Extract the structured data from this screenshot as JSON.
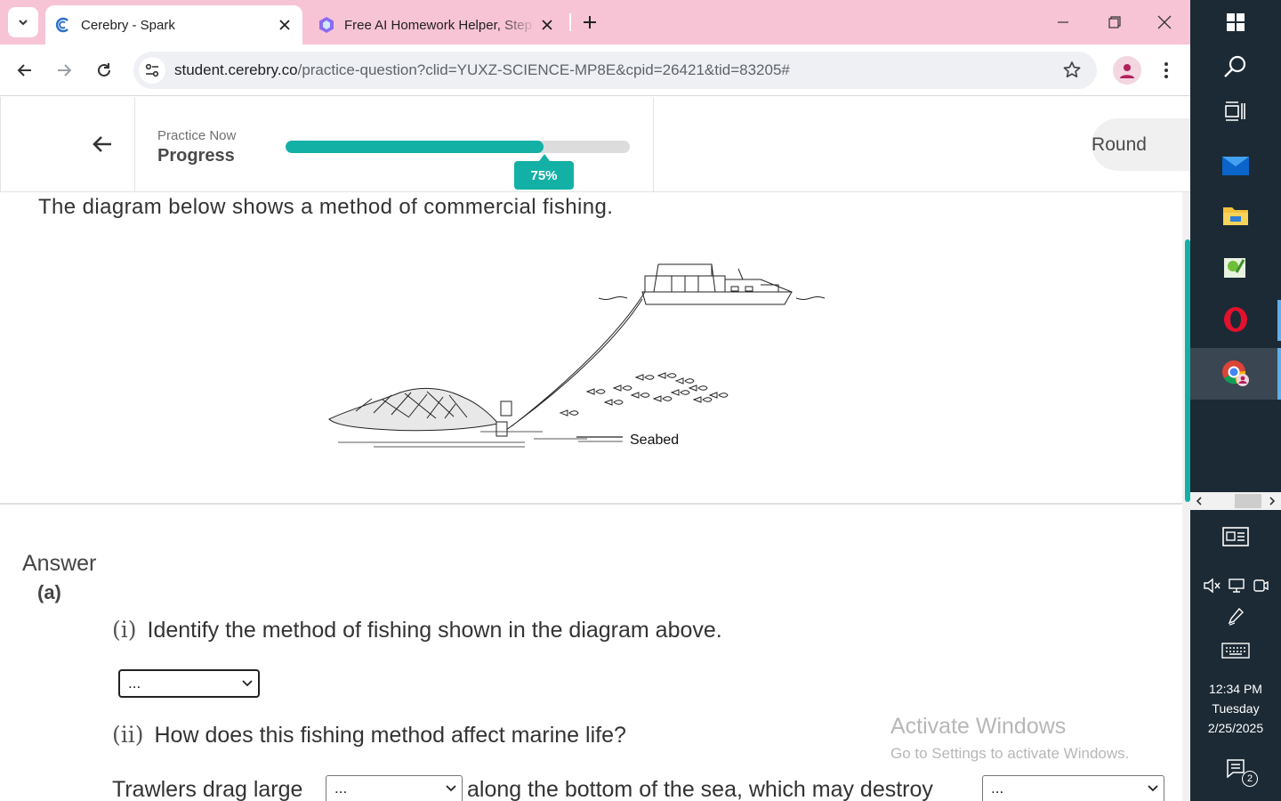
{
  "browser": {
    "tabs": [
      {
        "title": "Cerebry - Spark",
        "active": true,
        "icon": "cerebry-icon"
      },
      {
        "title": "Free AI Homework Helper, Step",
        "active": false,
        "icon": "ai-helper-icon"
      }
    ],
    "url_host": "student.cerebry.co",
    "url_path": "/practice-question?clid=YUXZ-SCIENCE-MP8E&cpid=26421&tid=83205#"
  },
  "header": {
    "progress_kicker": "Practice Now",
    "progress_label": "Progress",
    "progress_percent": 75,
    "progress_text": "75%",
    "round_label": "Round"
  },
  "question": {
    "intro": "The diagram below shows a method of commercial fishing.",
    "diagram_label": "Seabed"
  },
  "answer": {
    "heading": "Answer",
    "part": "(a)",
    "q1_num": "(i)",
    "q1_text": "Identify the method of fishing shown in the diagram above.",
    "q1_select": "...",
    "q2_num": "(ii)",
    "q2_text": "How does this fishing method affect marine life?",
    "q2_sentence_a": "Trawlers drag large",
    "q2_select_a": "...",
    "q2_sentence_b": "along the bottom of the sea, which may destroy",
    "q2_select_b": "..."
  },
  "watermark": {
    "line1": "Activate Windows",
    "line2": "Go to Settings to activate Windows."
  },
  "taskbar": {
    "time": "12:34 PM",
    "day": "Tuesday",
    "date": "2/25/2025",
    "notifications": "2"
  },
  "colors": {
    "accent": "#13b0a6",
    "tabstrip": "#f7c4d6",
    "taskbar": "#1c2a35"
  }
}
